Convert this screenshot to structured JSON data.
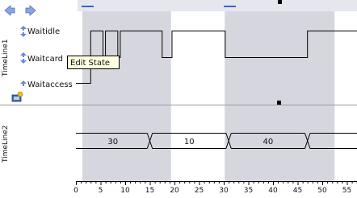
{
  "toolbar": {
    "back_icon": "left-arrow-icon",
    "forward_icon": "right-arrow-icon"
  },
  "timeline1": {
    "name": "TimeLine1",
    "states": [
      {
        "label": "Waitidle",
        "icon": "up-down-arrows-icon"
      },
      {
        "label": "Waitcard",
        "icon": "up-down-arrows-icon"
      },
      {
        "label": "Waitaccess",
        "icon": "up-arrow-icon"
      }
    ],
    "edit_icon": "edit-state-icon"
  },
  "tooltip": {
    "text": "Edit State"
  },
  "timeline2": {
    "name": "TimeLine2",
    "values": [
      {
        "label": "30",
        "from": 0,
        "to": 15
      },
      {
        "label": "10",
        "from": 15,
        "to": 31
      },
      {
        "label": "40",
        "from": 31,
        "to": 47
      },
      {
        "label": "",
        "from": 47,
        "to": 58
      }
    ]
  },
  "shaded_intervals": [
    {
      "from": 1.3,
      "to": 19.3
    },
    {
      "from": 30.2,
      "to": 52.5
    }
  ],
  "axis": {
    "ticks": [
      "0",
      "5",
      "10",
      "15",
      "20",
      "25",
      "30",
      "35",
      "40",
      "45",
      "50",
      "55"
    ],
    "tick_values": [
      0,
      5,
      10,
      15,
      20,
      25,
      30,
      35,
      40,
      45,
      50,
      55
    ],
    "min": 0,
    "max": 58
  },
  "waveform1": [
    {
      "t": 0,
      "level": "Waitaccess"
    },
    {
      "t": 3,
      "level": "Waitidle"
    },
    {
      "t": 5.5,
      "level": "Waitcard"
    },
    {
      "t": 6,
      "level": "Waitidle"
    },
    {
      "t": 8.5,
      "level": "Waitcard"
    },
    {
      "t": 9,
      "level": "Waitidle"
    },
    {
      "t": 17.5,
      "level": "Waitcard"
    },
    {
      "t": 19.5,
      "level": "Waitidle"
    },
    {
      "t": 30.3,
      "level": "Waitcard"
    },
    {
      "t": 47,
      "level": "Waitidle"
    },
    {
      "t": 58,
      "level": "Waitidle"
    }
  ],
  "colors": {
    "shade": "#d6d6de",
    "top_band": "#e6e6ee",
    "line": "#000000",
    "tooltip_bg": "#ffffe1",
    "nav_arrow": "#5a7fc8"
  }
}
